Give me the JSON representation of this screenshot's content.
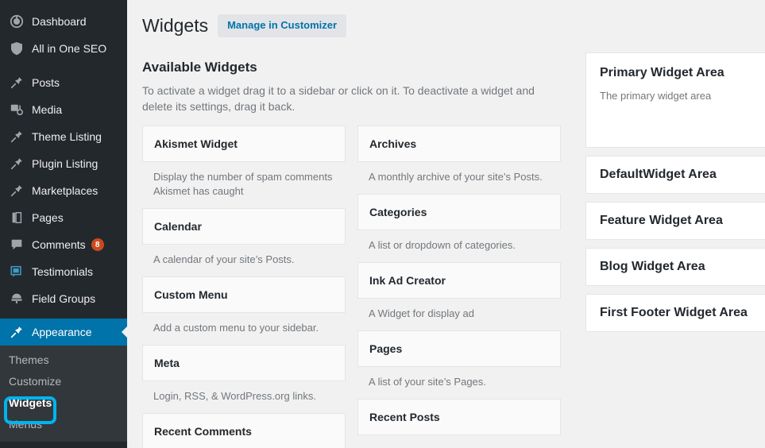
{
  "sidebar": {
    "items": [
      {
        "label": "Dashboard",
        "icon": "dashboard-icon",
        "badge": null
      },
      {
        "label": "All in One SEO",
        "icon": "shield-icon",
        "badge": null
      },
      {
        "label": "Posts",
        "icon": "pin-icon",
        "badge": null
      },
      {
        "label": "Media",
        "icon": "media-icon",
        "badge": null
      },
      {
        "label": "Theme Listing",
        "icon": "pin-icon",
        "badge": null
      },
      {
        "label": "Plugin Listing",
        "icon": "pin-icon",
        "badge": null
      },
      {
        "label": "Marketplaces",
        "icon": "pin-icon",
        "badge": null
      },
      {
        "label": "Pages",
        "icon": "pages-icon",
        "badge": null
      },
      {
        "label": "Comments",
        "icon": "comment-icon",
        "badge": "8"
      },
      {
        "label": "Testimonials",
        "icon": "testimonial-icon",
        "badge": null
      },
      {
        "label": "Field Groups",
        "icon": "field-groups-icon",
        "badge": null
      },
      {
        "label": "Appearance",
        "icon": "appearance-brush-icon",
        "badge": null
      }
    ],
    "submenu": [
      {
        "label": "Themes",
        "active": false
      },
      {
        "label": "Customize",
        "active": false
      },
      {
        "label": "Widgets",
        "active": true
      },
      {
        "label": "Menus",
        "active": false
      }
    ],
    "colors": {
      "background": "#23282d",
      "submenu_background": "#32373c",
      "current_item": "#0073aa",
      "badge": "#ca4a1f",
      "highlight_outline": "#00b4ee"
    }
  },
  "header": {
    "title": "Widgets",
    "customizer_button": "Manage in Customizer"
  },
  "available": {
    "title": "Available Widgets",
    "description": "To activate a widget drag it to a sidebar or click on it. To deactivate a widget and delete its settings, drag it back.",
    "column_left": [
      {
        "name": "Akismet Widget",
        "desc": "Display the number of spam comments Akismet has caught"
      },
      {
        "name": "Calendar",
        "desc": "A calendar of your site’s Posts."
      },
      {
        "name": "Custom Menu",
        "desc": "Add a custom menu to your sidebar."
      },
      {
        "name": "Meta",
        "desc": "Login, RSS, & WordPress.org links."
      },
      {
        "name": "Recent Comments",
        "desc": ""
      }
    ],
    "column_right": [
      {
        "name": "Archives",
        "desc": "A monthly archive of your site’s Posts."
      },
      {
        "name": "Categories",
        "desc": "A list or dropdown of categories."
      },
      {
        "name": "Ink Ad Creator",
        "desc": "A Widget for display ad"
      },
      {
        "name": "Pages",
        "desc": "A list of your site’s Pages."
      },
      {
        "name": "Recent Posts",
        "desc": ""
      }
    ]
  },
  "widget_areas": [
    {
      "title": "Primary Widget Area",
      "desc": "The primary widget area",
      "size": "tall"
    },
    {
      "title": "DefaultWidget Area",
      "desc": "",
      "size": "short"
    },
    {
      "title": "Feature Widget Area",
      "desc": "",
      "size": "short"
    },
    {
      "title": "Blog Widget Area",
      "desc": "",
      "size": "short"
    },
    {
      "title": "First Footer Widget Area",
      "desc": "",
      "size": "short"
    }
  ]
}
